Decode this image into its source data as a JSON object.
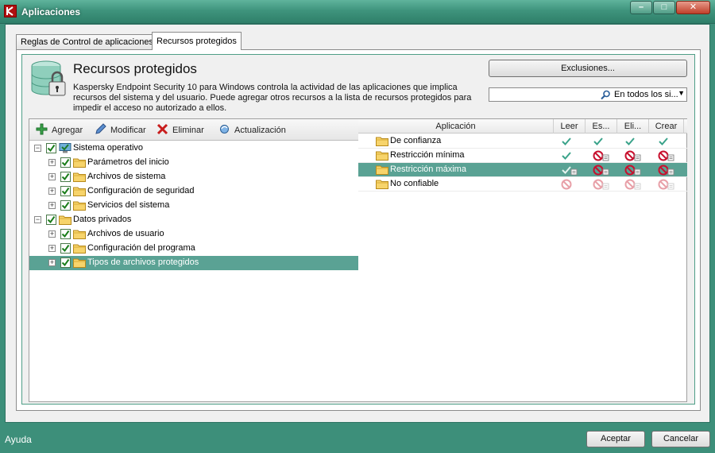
{
  "window": {
    "title": "Aplicaciones"
  },
  "tabs": [
    {
      "label": "Reglas de Control de aplicaciones"
    },
    {
      "label": "Recursos protegidos"
    }
  ],
  "header": {
    "title": "Recursos protegidos",
    "description": "Kaspersky Endpoint Security 10 para Windows controla la actividad de las aplicaciones que implica recursos del sistema y del usuario. Puede agregar otros recursos a la lista de recursos protegidos para impedir el acceso no autorizado a ellos."
  },
  "exclusions_button": "Exclusiones...",
  "search": {
    "value": "",
    "scope": "En todos los si..."
  },
  "toolbar": {
    "add": "Agregar",
    "edit": "Modificar",
    "delete": "Eliminar",
    "update": "Actualización"
  },
  "tree": [
    {
      "label": "Sistema operativo",
      "level": 0,
      "expanded": true,
      "checked": true,
      "icon": "computer-icon"
    },
    {
      "label": "Parámetros del inicio",
      "level": 1,
      "expanded": false,
      "checked": true,
      "icon": "folder-icon"
    },
    {
      "label": "Archivos de sistema",
      "level": 1,
      "expanded": false,
      "checked": true,
      "icon": "folder-icon"
    },
    {
      "label": "Configuración de seguridad",
      "level": 1,
      "expanded": false,
      "checked": true,
      "icon": "folder-icon"
    },
    {
      "label": "Servicios del sistema",
      "level": 1,
      "expanded": false,
      "checked": true,
      "icon": "folder-icon"
    },
    {
      "label": "Datos privados",
      "level": 0,
      "expanded": true,
      "checked": true,
      "icon": "folder-icon"
    },
    {
      "label": "Archivos de usuario",
      "level": 1,
      "expanded": false,
      "checked": true,
      "icon": "folder-icon"
    },
    {
      "label": "Configuración del programa",
      "level": 1,
      "expanded": false,
      "checked": true,
      "icon": "folder-icon"
    },
    {
      "label": "Tipos de archivos protegidos",
      "level": 1,
      "expanded": false,
      "checked": true,
      "icon": "folder-icon",
      "selected": true
    }
  ],
  "grid": {
    "columns": [
      "Aplicación",
      "Leer",
      "Es...",
      "Eli...",
      "Crear"
    ],
    "rows": [
      {
        "name": "De confianza",
        "perms": [
          "allow",
          "allow",
          "allow",
          "allow"
        ],
        "selected": false
      },
      {
        "name": "Restricción mínima",
        "perms": [
          "allow",
          "deny-log",
          "deny-log",
          "deny-log"
        ],
        "selected": false
      },
      {
        "name": "Restricción máxima",
        "perms": [
          "allow-log",
          "deny-log",
          "deny-log",
          "deny-log"
        ],
        "selected": true
      },
      {
        "name": "No confiable",
        "perms": [
          "deny-faded",
          "deny-log-faded",
          "deny-log-faded",
          "deny-log-faded"
        ],
        "selected": false
      }
    ]
  },
  "footer": {
    "help": "Ayuda",
    "ok": "Aceptar",
    "cancel": "Cancelar"
  },
  "colors": {
    "frame": "#3d8f7a",
    "selection": "#5aa294",
    "allow": "#3aa38a",
    "deny": "#c8102e"
  }
}
